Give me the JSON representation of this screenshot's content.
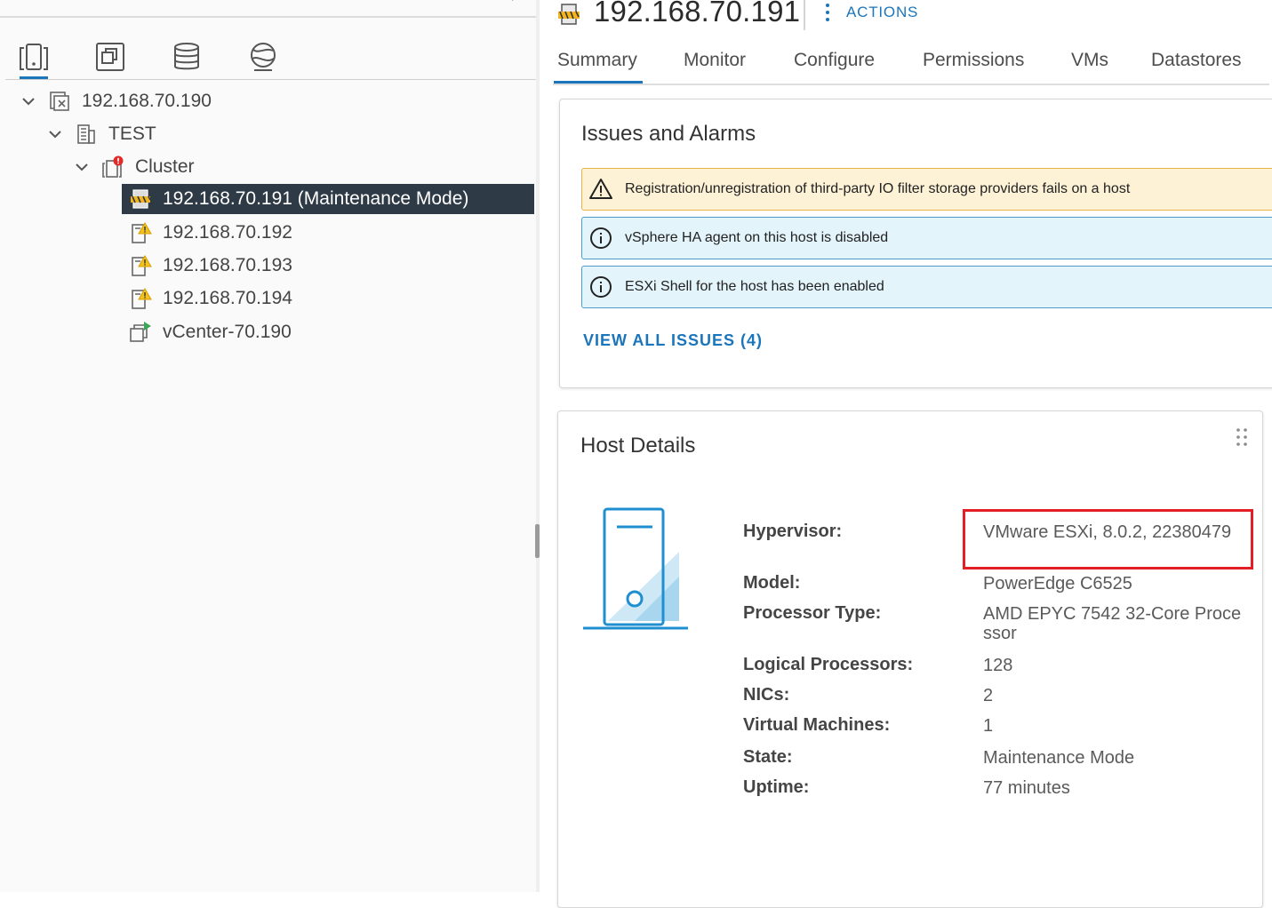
{
  "nav": {
    "view_tabs": [
      {
        "name": "hosts-clusters",
        "icon": "hosts-clusters-icon"
      },
      {
        "name": "vms-templates",
        "icon": "vms-templates-icon"
      },
      {
        "name": "storage",
        "icon": "storage-icon"
      },
      {
        "name": "networking",
        "icon": "networking-icon"
      }
    ],
    "tree": [
      {
        "label": "192.168.70.190",
        "icon": "vcenter-icon",
        "level": 0,
        "expanded": true
      },
      {
        "label": "TEST",
        "icon": "datacenter-icon",
        "level": 1,
        "expanded": true
      },
      {
        "label": "Cluster",
        "icon": "cluster-alert-icon",
        "level": 2,
        "expanded": true
      },
      {
        "label": "192.168.70.191 (Maintenance Mode)",
        "icon": "host-maintenance-icon",
        "level": 3,
        "selected": true
      },
      {
        "label": "192.168.70.192",
        "icon": "host-warning-icon",
        "level": 3
      },
      {
        "label": "192.168.70.193",
        "icon": "host-warning-icon",
        "level": 3
      },
      {
        "label": "192.168.70.194",
        "icon": "host-warning-icon",
        "level": 3
      },
      {
        "label": "vCenter-70.190",
        "icon": "vm-running-icon",
        "level": 3
      }
    ]
  },
  "header": {
    "title": "192.168.70.191",
    "actions_label": "ACTIONS"
  },
  "tabs": [
    "Summary",
    "Monitor",
    "Configure",
    "Permissions",
    "VMs",
    "Datastores"
  ],
  "issues": {
    "title": "Issues and Alarms",
    "alerts": [
      {
        "type": "warning",
        "text": "Registration/unregistration of third-party IO filter storage providers fails on a host"
      },
      {
        "type": "info",
        "text": "vSphere HA agent on this host is disabled"
      },
      {
        "type": "info",
        "text": "ESXi Shell for the host has been enabled"
      }
    ],
    "view_all_label": "VIEW ALL ISSUES (4)"
  },
  "host_details": {
    "title": "Host Details",
    "rows": [
      {
        "label": "Hypervisor:",
        "value": "VMware ESXi, 8.0.2, 22380479"
      },
      {
        "label": "Model:",
        "value": "PowerEdge C6525"
      },
      {
        "label": "Processor Type:",
        "value": "AMD EPYC 7542 32-Core Processor"
      },
      {
        "label": "Logical Processors:",
        "value": "128"
      },
      {
        "label": "NICs:",
        "value": "2"
      },
      {
        "label": "Virtual Machines:",
        "value": "1"
      },
      {
        "label": "State:",
        "value": "Maintenance Mode"
      },
      {
        "label": "Uptime:",
        "value": "77 minutes"
      }
    ]
  },
  "colors": {
    "accent": "#1b75bb",
    "selected_row_bg": "#2e3a45",
    "warning_bg": "#fdf1d6",
    "info_bg": "#e3f4fb",
    "highlight": "#e31e24"
  }
}
